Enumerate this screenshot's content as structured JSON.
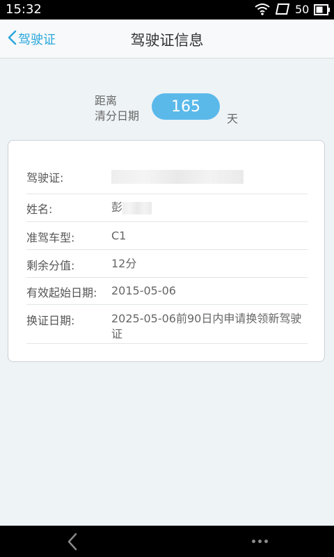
{
  "status_bar": {
    "time": "15:32",
    "battery": "50"
  },
  "header": {
    "back_label": "驾驶证",
    "title": "驾驶证信息"
  },
  "countdown": {
    "label_line1": "距离",
    "label_line2": "清分日期",
    "days": "165",
    "unit": "天"
  },
  "license": {
    "rows": [
      {
        "label": "驾驶证:",
        "value": ""
      },
      {
        "label": "姓名:",
        "value": "彭"
      },
      {
        "label": "准驾车型:",
        "value": "C1"
      },
      {
        "label": "剩余分值:",
        "value": "12分"
      },
      {
        "label": "有效起始日期:",
        "value": "2015-05-06"
      },
      {
        "label": "换证日期:",
        "value": "2025-05-06前90日内申请换领新驾驶证"
      }
    ]
  },
  "colors": {
    "accent": "#2aa6dc",
    "pill": "#5bb9ea",
    "background": "#eef3f6"
  }
}
